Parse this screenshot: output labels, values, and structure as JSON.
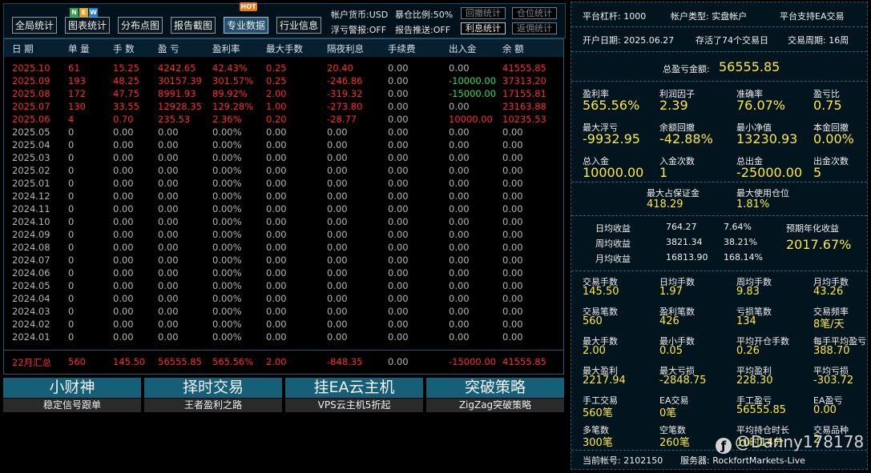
{
  "toolbar": {
    "buttons": [
      "全局统计",
      "图表统计",
      "分布点图",
      "报告截图",
      "专业数据",
      "行业信息"
    ],
    "badges": {
      "new": [
        "N",
        "E",
        "W"
      ],
      "hot": "HOT"
    },
    "info": [
      "帐户货币:USD",
      "暴仓比例:50%",
      "浮亏警报:OFF",
      "报告推送:OFF"
    ],
    "small_buttons": [
      "回撤统计",
      "仓位统计",
      "利息统计",
      "返佣统计"
    ]
  },
  "table": {
    "headers": [
      "日 期",
      "单 量",
      "手 数",
      "盈 亏",
      "盈利率",
      "最大手数",
      "隔夜利息",
      "手续费",
      "出入金",
      "余 额"
    ],
    "rows": [
      [
        "2025.10",
        "61",
        "15.25",
        "4242.65",
        "42.43%",
        "0.25",
        "20.40",
        "0.00",
        "0.00",
        "41555.85"
      ],
      [
        "2025.09",
        "193",
        "48.25",
        "30157.39",
        "301.57%",
        "0.25",
        "-246.86",
        "0.00",
        "-10000.00",
        "37313.20"
      ],
      [
        "2025.08",
        "172",
        "47.75",
        "8991.93",
        "89.92%",
        "2.00",
        "-319.32",
        "0.00",
        "-15000.00",
        "17155.81"
      ],
      [
        "2025.07",
        "130",
        "33.55",
        "12928.35",
        "129.28%",
        "1.00",
        "-273.80",
        "0.00",
        "0.00",
        "23163.88"
      ],
      [
        "2025.06",
        "4",
        "0.70",
        "235.53",
        "2.36%",
        "0.20",
        "-28.77",
        "0.00",
        "10000.00",
        "10235.53"
      ],
      [
        "2025.05",
        "0",
        "0.00",
        "0.00",
        "0.00%",
        "0.00",
        "0.00",
        "0.00",
        "0.00",
        "0.00"
      ],
      [
        "2025.04",
        "0",
        "0.00",
        "0.00",
        "0.00%",
        "0.00",
        "0.00",
        "0.00",
        "0.00",
        "0.00"
      ],
      [
        "2025.03",
        "0",
        "0.00",
        "0.00",
        "0.00%",
        "0.00",
        "0.00",
        "0.00",
        "0.00",
        "0.00"
      ],
      [
        "2025.02",
        "0",
        "0.00",
        "0.00",
        "0.00%",
        "0.00",
        "0.00",
        "0.00",
        "0.00",
        "0.00"
      ],
      [
        "2025.01",
        "0",
        "0.00",
        "0.00",
        "0.00%",
        "0.00",
        "0.00",
        "0.00",
        "0.00",
        "0.00"
      ],
      [
        "2024.12",
        "0",
        "0.00",
        "0.00",
        "0.00%",
        "0.00",
        "0.00",
        "0.00",
        "0.00",
        "0.00"
      ],
      [
        "2024.11",
        "0",
        "0.00",
        "0.00",
        "0.00%",
        "0.00",
        "0.00",
        "0.00",
        "0.00",
        "0.00"
      ],
      [
        "2024.10",
        "0",
        "0.00",
        "0.00",
        "0.00%",
        "0.00",
        "0.00",
        "0.00",
        "0.00",
        "0.00"
      ],
      [
        "2024.09",
        "0",
        "0.00",
        "0.00",
        "0.00%",
        "0.00",
        "0.00",
        "0.00",
        "0.00",
        "0.00"
      ],
      [
        "2024.08",
        "0",
        "0.00",
        "0.00",
        "0.00%",
        "0.00",
        "0.00",
        "0.00",
        "0.00",
        "0.00"
      ],
      [
        "2024.07",
        "0",
        "0.00",
        "0.00",
        "0.00%",
        "0.00",
        "0.00",
        "0.00",
        "0.00",
        "0.00"
      ],
      [
        "2024.06",
        "0",
        "0.00",
        "0.00",
        "0.00%",
        "0.00",
        "0.00",
        "0.00",
        "0.00",
        "0.00"
      ],
      [
        "2024.05",
        "0",
        "0.00",
        "0.00",
        "0.00%",
        "0.00",
        "0.00",
        "0.00",
        "0.00",
        "0.00"
      ],
      [
        "2024.04",
        "0",
        "0.00",
        "0.00",
        "0.00%",
        "0.00",
        "0.00",
        "0.00",
        "0.00",
        "0.00"
      ],
      [
        "2024.03",
        "0",
        "0.00",
        "0.00",
        "0.00%",
        "0.00",
        "0.00",
        "0.00",
        "0.00",
        "0.00"
      ],
      [
        "2024.02",
        "0",
        "0.00",
        "0.00",
        "0.00%",
        "0.00",
        "0.00",
        "0.00",
        "0.00",
        "0.00"
      ],
      [
        "2024.01",
        "0",
        "0.00",
        "0.00",
        "0.00%",
        "0.00",
        "0.00",
        "0.00",
        "0.00",
        "0.00"
      ]
    ],
    "summary": [
      "22月汇总",
      "560",
      "145.50",
      "56555.85",
      "565.56%",
      "2.00",
      "-848.35",
      "0.00",
      "-15000.00",
      "41555.85"
    ]
  },
  "promos": [
    {
      "title": "小财神",
      "sub": "稳定信号跟单"
    },
    {
      "title": "择时交易",
      "sub": "王者盈利之路"
    },
    {
      "title": "挂EA云主机",
      "sub": "VPS云主机5折起"
    },
    {
      "title": "突破策略",
      "sub": "ZigZag突破策略"
    }
  ],
  "right": {
    "line1": [
      "平台杠杆:  1000",
      "帐户类型:  实盘帐户",
      "平台支持EA交易"
    ],
    "line2": [
      "开户日期:  2025.06.27",
      "存活了74个交易日",
      "交易周期:  16周"
    ],
    "total_label": "总盈亏金额:",
    "total_value": "56555.85",
    "grid1": [
      {
        "label": "盈利率",
        "value": "565.56%"
      },
      {
        "label": "利润因子",
        "value": "2.39"
      },
      {
        "label": "准确率",
        "value": "76.07%"
      },
      {
        "label": "盈亏比",
        "value": "0.75"
      },
      {
        "label": "最大浮亏",
        "value": "-9932.95"
      },
      {
        "label": "余额回撤",
        "value": "-42.88%"
      },
      {
        "label": "最小净值",
        "value": "13230.93"
      },
      {
        "label": "本金回撤",
        "value": "0.00%"
      },
      {
        "label": "总入金",
        "value": "10000.00"
      },
      {
        "label": "入金次数",
        "value": "1"
      },
      {
        "label": "总出金",
        "value": "-25000.00"
      },
      {
        "label": "出金次数",
        "value": "5"
      }
    ],
    "margin": [
      {
        "label": "最大占保证金",
        "value": "418.29"
      },
      {
        "label": "最大使用仓位",
        "value": "1.81%"
      }
    ],
    "period": [
      {
        "label": "日均收益",
        "amount": "764.27",
        "pct": "7.64%"
      },
      {
        "label": "周均收益",
        "amount": "3821.34",
        "pct": "38.21%"
      },
      {
        "label": "月均收益",
        "amount": "16813.90",
        "pct": "168.14%"
      }
    ],
    "annual_label": "预期年化收益",
    "annual_value": "2017.67%",
    "grid2": [
      {
        "label": "交易手数",
        "value": "145.50"
      },
      {
        "label": "日均手数",
        "value": "1.97"
      },
      {
        "label": "周均手数",
        "value": "9.83"
      },
      {
        "label": "月均手数",
        "value": "43.26"
      },
      {
        "label": "交易笔数",
        "value": "560"
      },
      {
        "label": "盈利笔数",
        "value": "426"
      },
      {
        "label": "亏损笔数",
        "value": "134"
      },
      {
        "label": "交易频率",
        "value": "8笔/天"
      },
      {
        "label": "最大手数",
        "value": "2.00"
      },
      {
        "label": "最小手数",
        "value": "0.05"
      },
      {
        "label": "平均开仓手数",
        "value": "0.26"
      },
      {
        "label": "每手平均盈亏",
        "value": "388.70"
      },
      {
        "label": "最大盈利",
        "value": "2217.94"
      },
      {
        "label": "最大亏损",
        "value": "-2848.75"
      },
      {
        "label": "平均盈利",
        "value": "228.30"
      },
      {
        "label": "平均亏损",
        "value": "-303.72"
      },
      {
        "label": "手工交易",
        "value": "560笔"
      },
      {
        "label": "EA交易",
        "value": "0笔"
      },
      {
        "label": "手工盈亏",
        "value": "56555.85"
      },
      {
        "label": "EA盈亏",
        "value": "0.00"
      },
      {
        "label": "多笔数",
        "value": "300笔"
      },
      {
        "label": "空笔数",
        "value": "260笔"
      },
      {
        "label": "平均持仓时长",
        "value": "10时14分"
      },
      {
        "label": "交易品种",
        "value": "2"
      }
    ],
    "footer": [
      "当前帐号:  2102150",
      "服务器:  RockfortMarkets-Live"
    ]
  },
  "watermark": {
    "icon": "ƒ",
    "text": "@Danny178178"
  },
  "colors": {
    "positive": "#ff2a2a",
    "zero": "#b4b4b4",
    "negative": "#2ee05a",
    "value": "#ffe838",
    "header_bg": "#072031",
    "promo_bg": "#175f79"
  }
}
